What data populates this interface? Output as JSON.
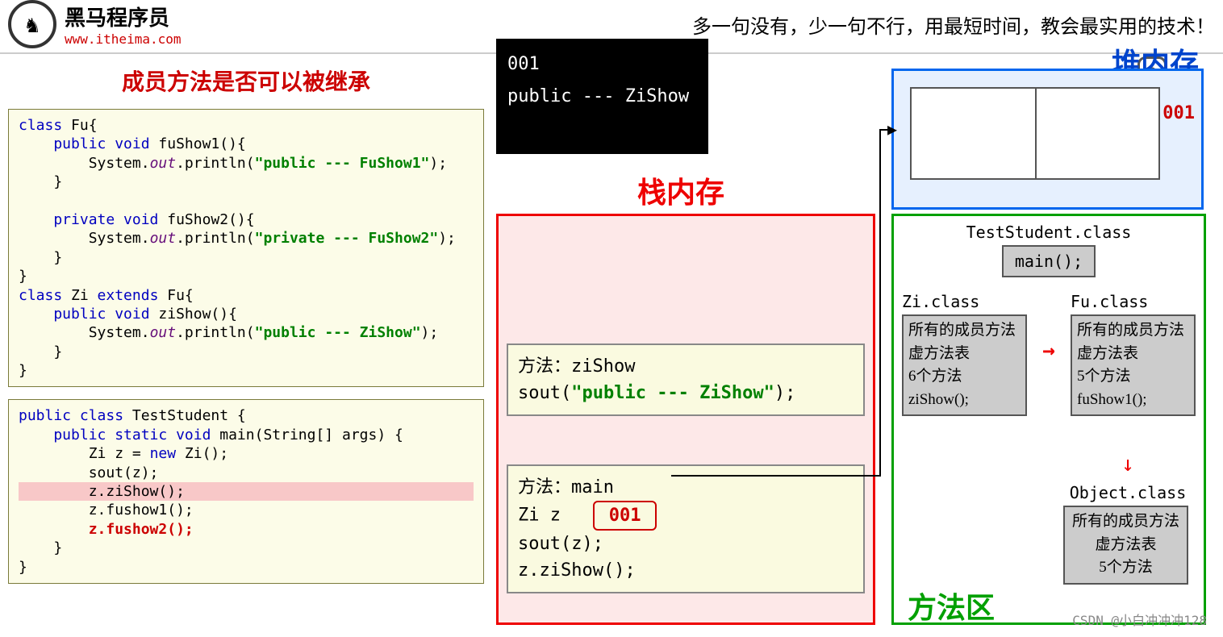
{
  "header": {
    "logo_char": "♞",
    "brand": "黑马程序员",
    "url": "www.itheima.com",
    "slogan": "多一句没有，少一句不行，用最短时间，教会最实用的技术！"
  },
  "title": "成员方法是否可以被继承",
  "code1": {
    "l1a": "class",
    "l1b": " Fu{",
    "l2a": "    public void",
    "l2b": " fuShow1(){",
    "l3a": "        System.",
    "l3b": "out",
    "l3c": ".println(",
    "l3d": "\"public --- FuShow1\"",
    "l3e": ");",
    "l4": "    }",
    "l5": "",
    "l6a": "    private void",
    "l6b": " fuShow2(){",
    "l7a": "        System.",
    "l7b": "out",
    "l7c": ".println(",
    "l7d": "\"private --- FuShow2\"",
    "l7e": ");",
    "l8": "    }",
    "l9": "}",
    "l10a": "class",
    "l10b": " Zi ",
    "l10c": "extends",
    "l10d": " Fu{",
    "l11a": "    public void",
    "l11b": " ziShow(){",
    "l12a": "        System.",
    "l12b": "out",
    "l12c": ".println(",
    "l12d": "\"public --- ZiShow\"",
    "l12e": ");",
    "l13": "    }",
    "l14": "}"
  },
  "code2": {
    "l1a": "public class",
    "l1b": " TestStudent {",
    "l2a": "    public static void",
    "l2b": " main(String[] args) {",
    "l3a": "        Zi z = ",
    "l3b": "new",
    "l3c": " Zi();",
    "l4": "        sout(z);",
    "l5": "        z.ziShow();",
    "l6": "        z.fushow1();",
    "l7": "        z.fushow2();",
    "l8": "    }",
    "l9": "}"
  },
  "console": {
    "line1": "001",
    "line2": "public --- ZiShow"
  },
  "stack": {
    "label": "栈内存",
    "frame1": {
      "title": "方法：ziShow",
      "line1a": "sout(",
      "line1b": "\"public --- ZiShow\"",
      "line1c": ");"
    },
    "frame2": {
      "title": "方法：main",
      "var": "Zi z",
      "addr": "001",
      "l2": "sout(z);",
      "l3": "z.ziShow();"
    }
  },
  "heap": {
    "label": "堆内存",
    "addr": "001"
  },
  "method_area": {
    "label": "方法区",
    "test_class": "TestStudent.class",
    "main_method": "main();",
    "zi_label": "Zi.class",
    "fu_label": "Fu.class",
    "zi_box": {
      "t": "所有的成员方法",
      "v1": "虚方法表",
      "v2": "   6个方法",
      "v3": " ziShow();"
    },
    "fu_box": {
      "t": "所有的成员方法",
      "v1": "虚方法表",
      "v2": "   5个方法",
      "v3": " fuShow1();"
    },
    "obj_label": "Object.class",
    "obj_box": {
      "t": "所有的成员方法",
      "v1": "虚方法表",
      "v2": "",
      "v3": "   5个方法"
    }
  },
  "arrow": "→",
  "arrow_down": "↓",
  "watermark": "CSDN @小白冲冲冲128"
}
